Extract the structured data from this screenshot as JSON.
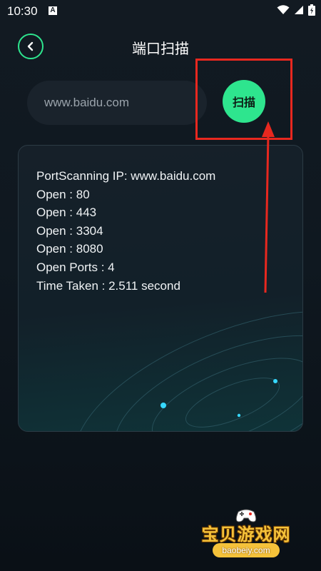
{
  "status_bar": {
    "time": "10:30",
    "notification_icon": "A"
  },
  "header": {
    "title": "端口扫描",
    "back_icon": "chevron-left-icon"
  },
  "search": {
    "host_value": "www.baidu.com",
    "scan_button_label": "扫描"
  },
  "result": {
    "lines": [
      "PortScanning IP: www.baidu.com",
      "Open : 80",
      "Open : 443",
      "Open : 3304",
      "Open : 8080",
      "Open Ports : 4",
      "Time Taken : 2.511 second"
    ]
  },
  "watermark": {
    "title": "宝贝游戏网",
    "url": "baobeiy.com"
  },
  "colors": {
    "accent": "#2ee58e",
    "annotation": "#e8281f",
    "background": "#121a22"
  }
}
